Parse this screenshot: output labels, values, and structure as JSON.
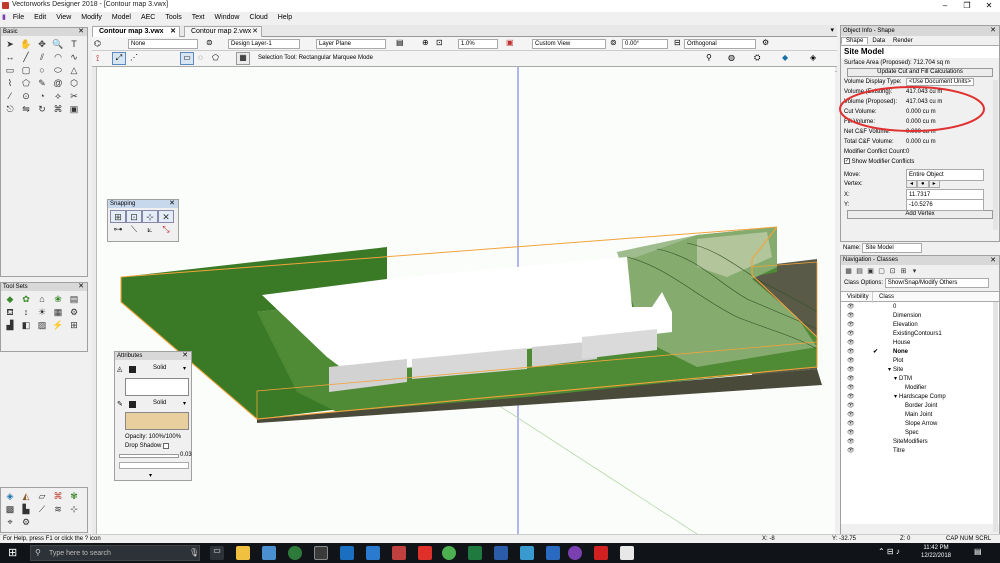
{
  "window": {
    "title": "Vectorworks Designer 2018 - [Contour map 3.vwx]"
  },
  "menu": [
    "File",
    "Edit",
    "View",
    "Modify",
    "Model",
    "AEC",
    "Tools",
    "Text",
    "Window",
    "Cloud",
    "Help"
  ],
  "basic_palette": {
    "title": "Basic"
  },
  "toolsets_palette": {
    "title": "Tool Sets"
  },
  "tabs": [
    {
      "label": "Contour map 3.vwx"
    },
    {
      "label": "Contour map 2.vwx"
    }
  ],
  "view_bar": {
    "class": "None",
    "layer": "Design Layer-1",
    "plane": "Layer Plane",
    "zoom": "1.0%",
    "view": "Custom View",
    "angle": "0.00°",
    "projection": "Orthogonal"
  },
  "mode_bar": {
    "mode_text": "Selection Tool: Rectangular Marquee Mode"
  },
  "snapping": {
    "title": "Snapping"
  },
  "attributes": {
    "title": "Attributes",
    "fill_style": "Solid",
    "pen_style": "Solid",
    "opacity": "Opacity: 100%/100%",
    "drop_shadow": "Drop Shadow",
    "line_weight": "0.03",
    "fill_color": "#e9cf9e"
  },
  "object_info": {
    "title": "Object Info - Shape",
    "tabs": [
      "Shape",
      "Data",
      "Render"
    ],
    "object_name": "Site Model",
    "surface_area": "Surface Area (Proposed): 712.704  sq m",
    "update_button": "Update Cut and Fill Calculations",
    "rows": [
      {
        "label": "Volume Display Type:",
        "value": "<Use Document Units>"
      },
      {
        "label": "Volume (Existing):",
        "value": "417.043  cu m"
      },
      {
        "label": "Volume (Proposed):",
        "value": "417.043  cu m"
      },
      {
        "label": "Cut Volume:",
        "value": "0.000  cu m"
      },
      {
        "label": "Fill Volume:",
        "value": "0.000  cu m"
      },
      {
        "label": "Net C&F Volume:",
        "value": "0.000  cu m"
      },
      {
        "label": "Total C&F Volume:",
        "value": "0.000  cu m"
      },
      {
        "label": "Modifier Conflict Count:",
        "value": "0"
      }
    ],
    "show_conflicts": "Show Modifier Conflicts",
    "move_label": "Move:",
    "move_value": "Entire Object",
    "vertex_label": "Vertex:",
    "x_label": "X:",
    "x_value": "11.7317",
    "y_label": "Y:",
    "y_value": "-10.5276",
    "add_vertex": "Add Vertex",
    "name_label": "Name:",
    "name_value": "Site Model"
  },
  "navigation": {
    "title": "Navigation - Classes",
    "class_options_label": "Class Options:",
    "class_options_value": "Show/Snap/Modify Others",
    "col_visibility": "Visibility",
    "col_class": "Class",
    "classes": [
      {
        "name": "0",
        "indent": 0,
        "bold": false,
        "tw": false
      },
      {
        "name": "Dimension",
        "indent": 0,
        "bold": false,
        "tw": false
      },
      {
        "name": "Elevation",
        "indent": 0,
        "bold": false,
        "tw": false
      },
      {
        "name": "ExistingContours1",
        "indent": 0,
        "bold": false,
        "tw": false
      },
      {
        "name": "House",
        "indent": 0,
        "bold": false,
        "tw": false
      },
      {
        "name": "None",
        "indent": 0,
        "bold": true,
        "tw": false
      },
      {
        "name": "Plot",
        "indent": 0,
        "bold": false,
        "tw": false
      },
      {
        "name": "Site",
        "indent": 0,
        "bold": false,
        "tw": true
      },
      {
        "name": "DTM",
        "indent": 1,
        "bold": false,
        "tw": true
      },
      {
        "name": "Modifier",
        "indent": 2,
        "bold": false,
        "tw": false
      },
      {
        "name": "Hardscape Comp",
        "indent": 1,
        "bold": false,
        "tw": true
      },
      {
        "name": "Border Joint",
        "indent": 2,
        "bold": false,
        "tw": false
      },
      {
        "name": "Main Joint",
        "indent": 2,
        "bold": false,
        "tw": false
      },
      {
        "name": "Slope Arrow",
        "indent": 2,
        "bold": false,
        "tw": false
      },
      {
        "name": "Spec",
        "indent": 2,
        "bold": false,
        "tw": false
      },
      {
        "name": "SiteModifiers",
        "indent": 0,
        "bold": false,
        "tw": false
      },
      {
        "name": "Titre",
        "indent": 0,
        "bold": false,
        "tw": false
      }
    ]
  },
  "status": {
    "help": "For Help, press F1 or click the ? icon",
    "x": "X: -8",
    "y": "Y: -32.75",
    "z": "Z: 0",
    "indicators": "CAP  NUM  SCRL"
  },
  "taskbar": {
    "search_placeholder": "Type here to search",
    "time": "11:42 PM",
    "date": "12/22/2018"
  },
  "colors": {
    "accent": "#e03030",
    "terrain_green": "#3f7a2a",
    "bbox_orange": "#f2a33a",
    "taskbar": "#101418"
  }
}
